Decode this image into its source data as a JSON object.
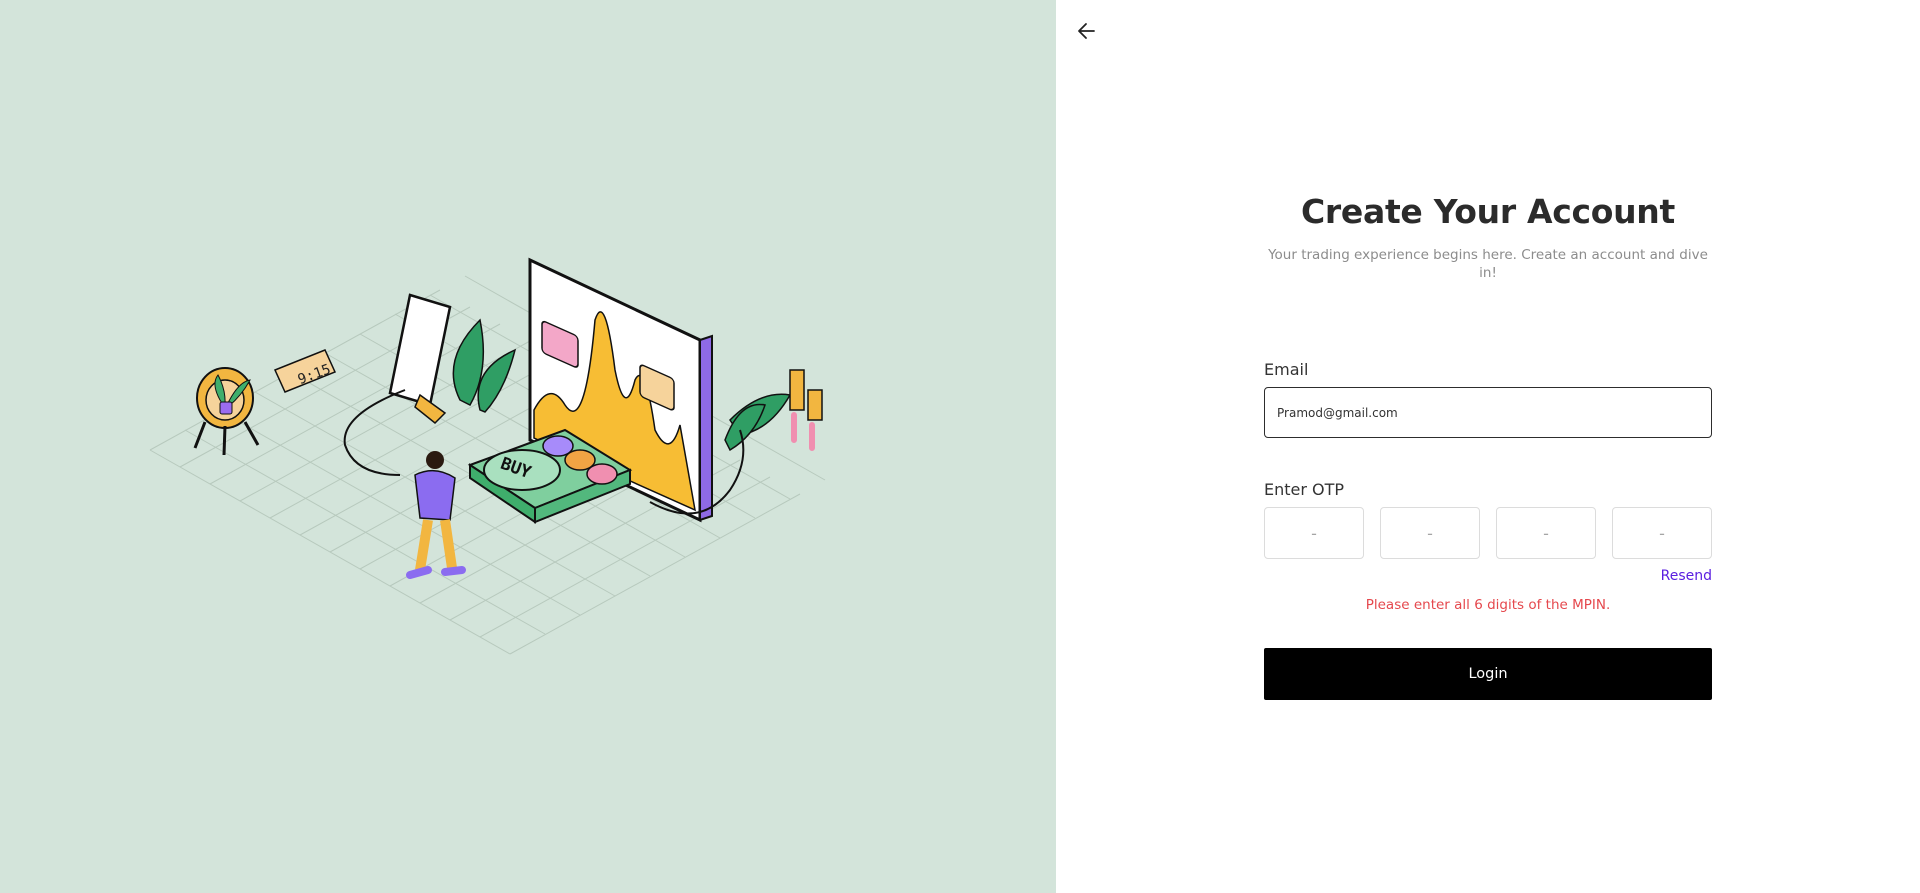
{
  "illustration": {
    "clock_text": "9:15",
    "buy_text": "BUY"
  },
  "form": {
    "title": "Create Your Account",
    "subtitle": "Your trading experience begins here. Create an account and dive in!",
    "email_label": "Email",
    "email_value": "Pramod@gmail.com",
    "otp_label": "Enter OTP",
    "otp_placeholder": "-",
    "resend_label": "Resend",
    "error_text": "Please enter all 6 digits of the MPIN.",
    "login_label": "Login"
  },
  "colors": {
    "left_panel_bg": "#d3e4da",
    "accent_purple": "#5a1ee0",
    "error_red": "#e5484d",
    "button_black": "#000000"
  },
  "icons": {
    "back": "arrow-left-icon"
  }
}
